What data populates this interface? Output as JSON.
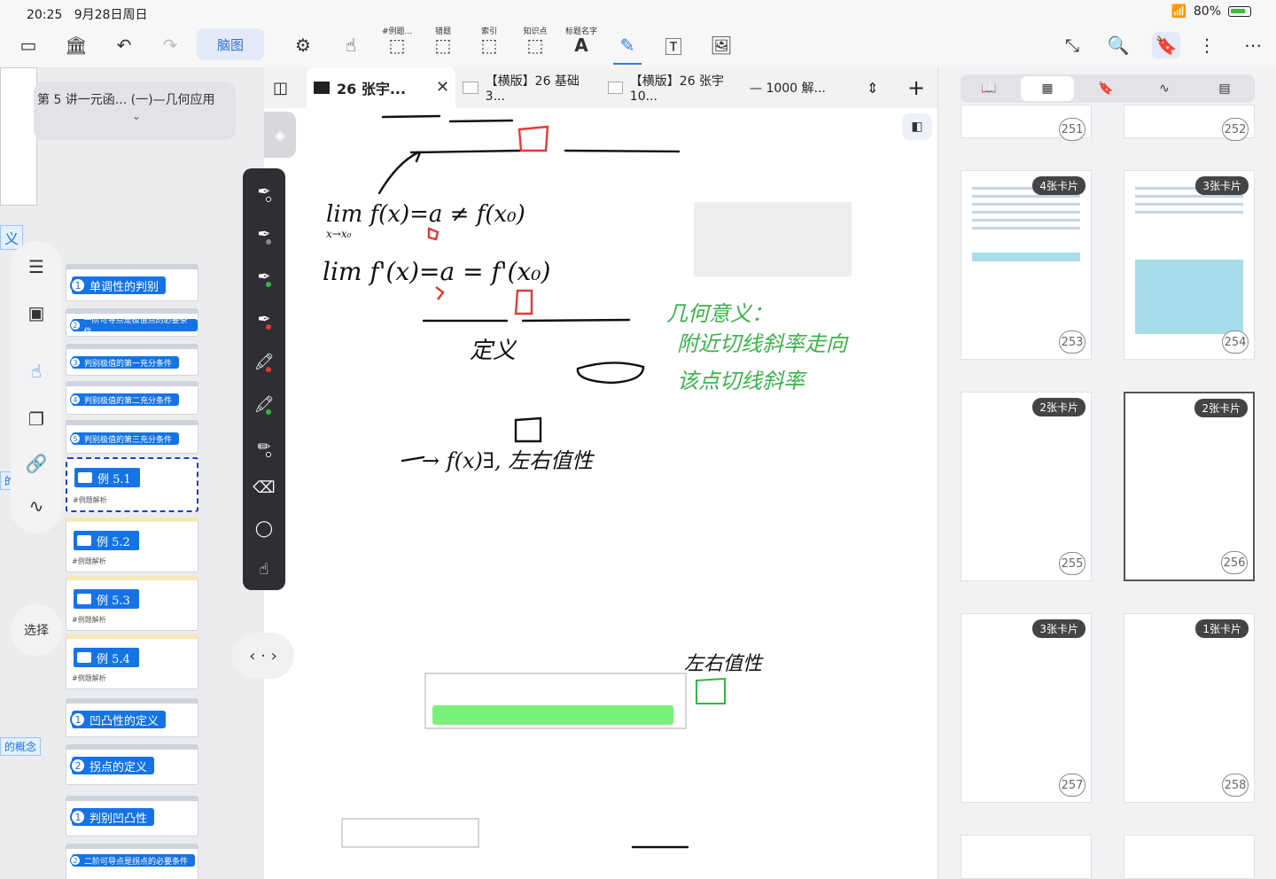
{
  "status": {
    "time": "20:25",
    "date": "9月28日周日",
    "battery": "80%"
  },
  "toolbar": {
    "mindmap_label": "脑图",
    "mini_labels": [
      "#例题...",
      "错题",
      "索引",
      "知识点",
      "标题名字"
    ]
  },
  "left": {
    "chapter_title": "第 5 讲一元函... (一)—几何应用",
    "chapter_chevron": "⌄",
    "select_label": "选择",
    "chips": [
      "义",
      "的判别",
      "的概念"
    ],
    "nodes": [
      {
        "num": "1",
        "label": "单调性的判别",
        "small": false
      },
      {
        "num": "2",
        "label": "一阶可导点是极值点的必要条件",
        "small": true
      },
      {
        "num": "3",
        "label": "判别极值的第一充分条件",
        "small": true
      },
      {
        "num": "4",
        "label": "判别极值的第二充分条件",
        "small": true
      },
      {
        "num": "5",
        "label": "判别极值的第三充分条件",
        "small": true
      }
    ],
    "examples": [
      {
        "label": "例 5.1",
        "tag": "#例题解析"
      },
      {
        "label": "例 5.2",
        "tag": "#例题解析"
      },
      {
        "label": "例 5.3",
        "tag": "#例题解析"
      },
      {
        "label": "例 5.4",
        "tag": "#例题解析"
      }
    ],
    "nodes2": [
      {
        "num": "1",
        "label": "凹凸性的定义",
        "small": false
      },
      {
        "num": "2",
        "label": "拐点的定义",
        "small": false
      },
      {
        "num": "1",
        "label": "判别凹凸性",
        "small": false
      },
      {
        "num": "2",
        "label": "二阶可导点是拐点的必要条件",
        "small": true
      }
    ]
  },
  "tabs": [
    {
      "label": "26 张宇...",
      "active": true
    },
    {
      "label": "【横版】26 基础 3...",
      "active": false
    },
    {
      "label": "【横版】26 张宇 10...",
      "active": false
    },
    {
      "label": "— 1000 解...",
      "active": false
    }
  ],
  "tab_close": "✕",
  "canvas": {
    "handwriting": [
      "lim f(x)=a ≠ f(x₀)",
      "x→x₀",
      "lim f'(x)=a = f'(x₀)",
      "定义",
      "→ f(x)∃, 左右值性",
      "几何意义：",
      "附近切线斜率走向",
      "该点切线斜率",
      "左右值性"
    ]
  },
  "pages": [
    {
      "num": "251",
      "badge": ""
    },
    {
      "num": "252",
      "badge": ""
    },
    {
      "num": "253",
      "badge": "4张卡片"
    },
    {
      "num": "254",
      "badge": "3张卡片"
    },
    {
      "num": "255",
      "badge": "2张卡片"
    },
    {
      "num": "256",
      "badge": "2张卡片"
    },
    {
      "num": "257",
      "badge": "3张卡片"
    },
    {
      "num": "258",
      "badge": "1张卡片"
    }
  ],
  "colors": {
    "accent": "#1673e6",
    "ink_green": "#3ab34a",
    "ink_red": "#e53935",
    "highlight_green": "#6cf06c"
  }
}
